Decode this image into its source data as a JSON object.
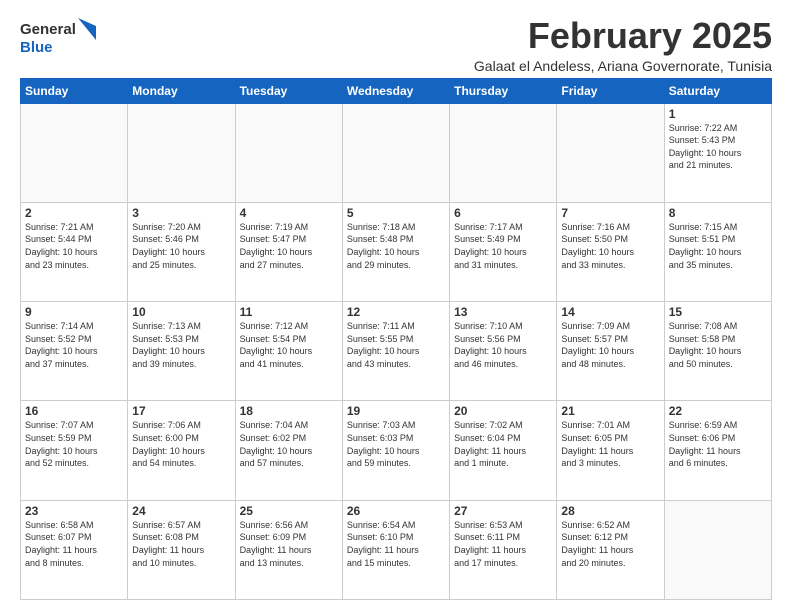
{
  "logo": {
    "general": "General",
    "blue": "Blue"
  },
  "header": {
    "month": "February 2025",
    "location": "Galaat el Andeless, Ariana Governorate, Tunisia"
  },
  "days": [
    "Sunday",
    "Monday",
    "Tuesday",
    "Wednesday",
    "Thursday",
    "Friday",
    "Saturday"
  ],
  "weeks": [
    [
      {
        "day": "",
        "info": ""
      },
      {
        "day": "",
        "info": ""
      },
      {
        "day": "",
        "info": ""
      },
      {
        "day": "",
        "info": ""
      },
      {
        "day": "",
        "info": ""
      },
      {
        "day": "",
        "info": ""
      },
      {
        "day": "1",
        "info": "Sunrise: 7:22 AM\nSunset: 5:43 PM\nDaylight: 10 hours\nand 21 minutes."
      }
    ],
    [
      {
        "day": "2",
        "info": "Sunrise: 7:21 AM\nSunset: 5:44 PM\nDaylight: 10 hours\nand 23 minutes."
      },
      {
        "day": "3",
        "info": "Sunrise: 7:20 AM\nSunset: 5:46 PM\nDaylight: 10 hours\nand 25 minutes."
      },
      {
        "day": "4",
        "info": "Sunrise: 7:19 AM\nSunset: 5:47 PM\nDaylight: 10 hours\nand 27 minutes."
      },
      {
        "day": "5",
        "info": "Sunrise: 7:18 AM\nSunset: 5:48 PM\nDaylight: 10 hours\nand 29 minutes."
      },
      {
        "day": "6",
        "info": "Sunrise: 7:17 AM\nSunset: 5:49 PM\nDaylight: 10 hours\nand 31 minutes."
      },
      {
        "day": "7",
        "info": "Sunrise: 7:16 AM\nSunset: 5:50 PM\nDaylight: 10 hours\nand 33 minutes."
      },
      {
        "day": "8",
        "info": "Sunrise: 7:15 AM\nSunset: 5:51 PM\nDaylight: 10 hours\nand 35 minutes."
      }
    ],
    [
      {
        "day": "9",
        "info": "Sunrise: 7:14 AM\nSunset: 5:52 PM\nDaylight: 10 hours\nand 37 minutes."
      },
      {
        "day": "10",
        "info": "Sunrise: 7:13 AM\nSunset: 5:53 PM\nDaylight: 10 hours\nand 39 minutes."
      },
      {
        "day": "11",
        "info": "Sunrise: 7:12 AM\nSunset: 5:54 PM\nDaylight: 10 hours\nand 41 minutes."
      },
      {
        "day": "12",
        "info": "Sunrise: 7:11 AM\nSunset: 5:55 PM\nDaylight: 10 hours\nand 43 minutes."
      },
      {
        "day": "13",
        "info": "Sunrise: 7:10 AM\nSunset: 5:56 PM\nDaylight: 10 hours\nand 46 minutes."
      },
      {
        "day": "14",
        "info": "Sunrise: 7:09 AM\nSunset: 5:57 PM\nDaylight: 10 hours\nand 48 minutes."
      },
      {
        "day": "15",
        "info": "Sunrise: 7:08 AM\nSunset: 5:58 PM\nDaylight: 10 hours\nand 50 minutes."
      }
    ],
    [
      {
        "day": "16",
        "info": "Sunrise: 7:07 AM\nSunset: 5:59 PM\nDaylight: 10 hours\nand 52 minutes."
      },
      {
        "day": "17",
        "info": "Sunrise: 7:06 AM\nSunset: 6:00 PM\nDaylight: 10 hours\nand 54 minutes."
      },
      {
        "day": "18",
        "info": "Sunrise: 7:04 AM\nSunset: 6:02 PM\nDaylight: 10 hours\nand 57 minutes."
      },
      {
        "day": "19",
        "info": "Sunrise: 7:03 AM\nSunset: 6:03 PM\nDaylight: 10 hours\nand 59 minutes."
      },
      {
        "day": "20",
        "info": "Sunrise: 7:02 AM\nSunset: 6:04 PM\nDaylight: 11 hours\nand 1 minute."
      },
      {
        "day": "21",
        "info": "Sunrise: 7:01 AM\nSunset: 6:05 PM\nDaylight: 11 hours\nand 3 minutes."
      },
      {
        "day": "22",
        "info": "Sunrise: 6:59 AM\nSunset: 6:06 PM\nDaylight: 11 hours\nand 6 minutes."
      }
    ],
    [
      {
        "day": "23",
        "info": "Sunrise: 6:58 AM\nSunset: 6:07 PM\nDaylight: 11 hours\nand 8 minutes."
      },
      {
        "day": "24",
        "info": "Sunrise: 6:57 AM\nSunset: 6:08 PM\nDaylight: 11 hours\nand 10 minutes."
      },
      {
        "day": "25",
        "info": "Sunrise: 6:56 AM\nSunset: 6:09 PM\nDaylight: 11 hours\nand 13 minutes."
      },
      {
        "day": "26",
        "info": "Sunrise: 6:54 AM\nSunset: 6:10 PM\nDaylight: 11 hours\nand 15 minutes."
      },
      {
        "day": "27",
        "info": "Sunrise: 6:53 AM\nSunset: 6:11 PM\nDaylight: 11 hours\nand 17 minutes."
      },
      {
        "day": "28",
        "info": "Sunrise: 6:52 AM\nSunset: 6:12 PM\nDaylight: 11 hours\nand 20 minutes."
      },
      {
        "day": "",
        "info": ""
      }
    ]
  ]
}
